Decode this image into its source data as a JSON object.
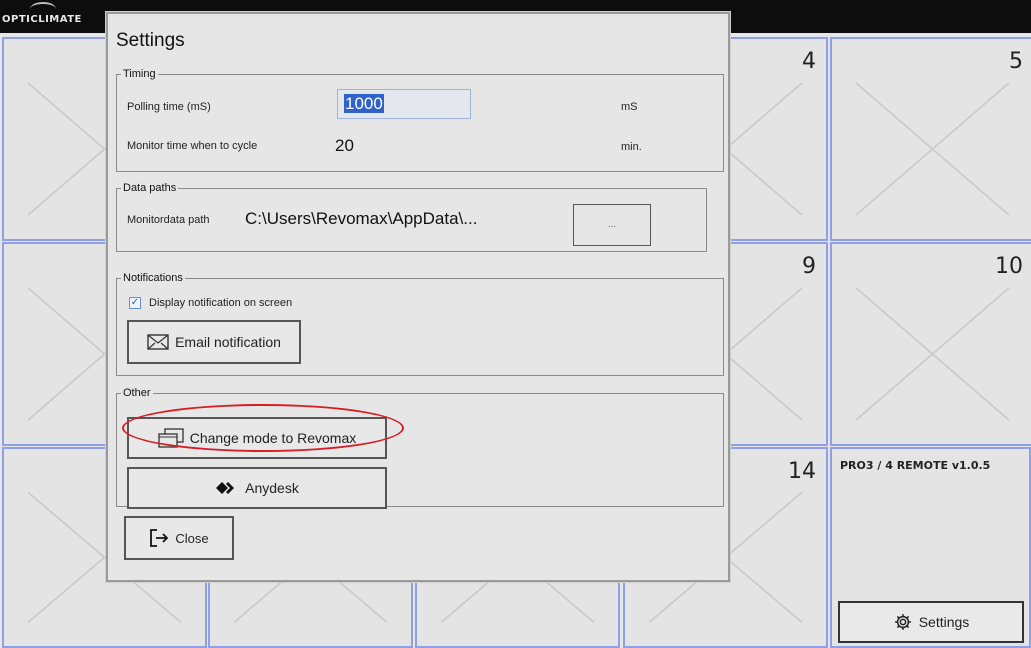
{
  "app": {
    "logo": "OPTICLIMATE"
  },
  "tiles": [
    {
      "num": ""
    },
    {
      "num": ""
    },
    {
      "num": ""
    },
    {
      "num": "4"
    },
    {
      "num": "5"
    },
    {
      "num": ""
    },
    {
      "num": ""
    },
    {
      "num": ""
    },
    {
      "num": "9"
    },
    {
      "num": "10"
    },
    {
      "num": ""
    },
    {
      "num": ""
    },
    {
      "num": ""
    },
    {
      "num": "14"
    }
  ],
  "remote_panel": {
    "version": "PRO3 / 4 REMOTE v1.0.5",
    "settings_label": "Settings"
  },
  "dialog": {
    "title": "Settings",
    "timing": {
      "legend": "Timing",
      "polling_label": "Polling time (mS)",
      "polling_value": "1000",
      "polling_unit": "mS",
      "monitor_label": "Monitor time when to cycle",
      "monitor_value": "20",
      "monitor_unit": "min."
    },
    "data_paths": {
      "legend": "Data paths",
      "monitor_label": "Monitordata path",
      "monitor_value": "C:\\Users\\Revomax\\AppData\\...",
      "browse_label": "..."
    },
    "notifications": {
      "legend": "Notifications",
      "display_label": "Display notification on screen",
      "display_checked": true,
      "email_label": "Email notification"
    },
    "other": {
      "legend": "Other",
      "change_mode_label": "Change mode to Revomax",
      "anydesk_label": "Anydesk"
    },
    "close_label": "Close"
  },
  "colors": {
    "tile_border": "#8fa0e8",
    "highlight": "#d81e25",
    "selection": "#2f63c8"
  }
}
